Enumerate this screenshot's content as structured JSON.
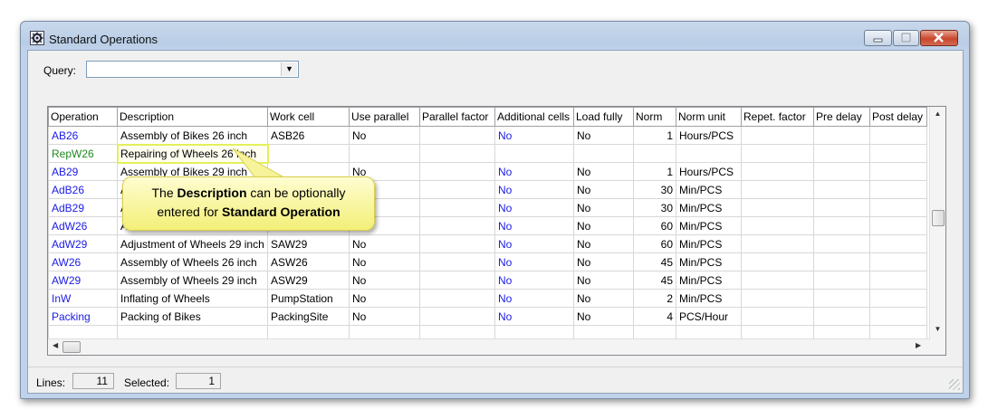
{
  "window": {
    "title": "Standard Operations"
  },
  "query": {
    "label": "Query:",
    "value": ""
  },
  "grid": {
    "columns": [
      "Operation",
      "Description",
      "Work cell",
      "Use parallel",
      "Parallel factor",
      "Additional cells",
      "Load fully",
      "Norm",
      "Norm unit",
      "Repet. factor",
      "Pre delay",
      "Post delay"
    ],
    "rows": [
      {
        "operation": "AB26",
        "description": "Assembly of Bikes 26 inch",
        "work_cell": "ASB26",
        "use_parallel": "No",
        "parallel_factor": "",
        "additional_cells": "No",
        "load_fully": "No",
        "norm": "1",
        "norm_unit": "Hours/PCS",
        "repet_factor": "",
        "pre_delay": "",
        "post_delay": ""
      },
      {
        "operation": "RepW26",
        "description": "Repairing of Wheels 26 inch",
        "work_cell": "",
        "use_parallel": "",
        "parallel_factor": "",
        "additional_cells": "",
        "load_fully": "",
        "norm": "",
        "norm_unit": "",
        "repet_factor": "",
        "pre_delay": "",
        "post_delay": ""
      },
      {
        "operation": "AB29",
        "description": "Assembly of Bikes 29 inch",
        "work_cell": "",
        "use_parallel": "No",
        "parallel_factor": "",
        "additional_cells": "No",
        "load_fully": "No",
        "norm": "1",
        "norm_unit": "Hours/PCS",
        "repet_factor": "",
        "pre_delay": "",
        "post_delay": ""
      },
      {
        "operation": "AdB26",
        "description": "Ad",
        "work_cell": "",
        "use_parallel": "",
        "parallel_factor": "",
        "additional_cells": "No",
        "load_fully": "No",
        "norm": "30",
        "norm_unit": "Min/PCS",
        "repet_factor": "",
        "pre_delay": "",
        "post_delay": ""
      },
      {
        "operation": "AdB29",
        "description": "Ad",
        "work_cell": "",
        "use_parallel": "",
        "parallel_factor": "",
        "additional_cells": "No",
        "load_fully": "No",
        "norm": "30",
        "norm_unit": "Min/PCS",
        "repet_factor": "",
        "pre_delay": "",
        "post_delay": ""
      },
      {
        "operation": "AdW26",
        "description": "Ad",
        "work_cell": "",
        "use_parallel": "",
        "parallel_factor": "",
        "additional_cells": "No",
        "load_fully": "No",
        "norm": "60",
        "norm_unit": "Min/PCS",
        "repet_factor": "",
        "pre_delay": "",
        "post_delay": ""
      },
      {
        "operation": "AdW29",
        "description": "Adjustment of Wheels 29 inch",
        "work_cell": "SAW29",
        "use_parallel": "No",
        "parallel_factor": "",
        "additional_cells": "No",
        "load_fully": "No",
        "norm": "60",
        "norm_unit": "Min/PCS",
        "repet_factor": "",
        "pre_delay": "",
        "post_delay": ""
      },
      {
        "operation": "AW26",
        "description": "Assembly of Wheels 26 inch",
        "work_cell": "ASW26",
        "use_parallel": "No",
        "parallel_factor": "",
        "additional_cells": "No",
        "load_fully": "No",
        "norm": "45",
        "norm_unit": "Min/PCS",
        "repet_factor": "",
        "pre_delay": "",
        "post_delay": ""
      },
      {
        "operation": "AW29",
        "description": "Assembly of Wheels 29 inch",
        "work_cell": "ASW29",
        "use_parallel": "No",
        "parallel_factor": "",
        "additional_cells": "No",
        "load_fully": "No",
        "norm": "45",
        "norm_unit": "Min/PCS",
        "repet_factor": "",
        "pre_delay": "",
        "post_delay": ""
      },
      {
        "operation": "InW",
        "description": "Inflating of Wheels",
        "work_cell": "PumpStation",
        "use_parallel": "No",
        "parallel_factor": "",
        "additional_cells": "No",
        "load_fully": "No",
        "norm": "2",
        "norm_unit": "Min/PCS",
        "repet_factor": "",
        "pre_delay": "",
        "post_delay": ""
      },
      {
        "operation": "Packing",
        "description": "Packing of Bikes",
        "work_cell": "PackingSite",
        "use_parallel": "No",
        "parallel_factor": "",
        "additional_cells": "No",
        "load_fully": "No",
        "norm": "4",
        "norm_unit": "PCS/Hour",
        "repet_factor": "",
        "pre_delay": "",
        "post_delay": ""
      }
    ],
    "editing_row": 1
  },
  "status": {
    "lines_label": "Lines:",
    "lines_value": "11",
    "selected_label": "Selected:",
    "selected_value": "1"
  },
  "callout": {
    "line1_pre": "The ",
    "line1_bold": "Description",
    "line1_post": " can be optionally",
    "line2_pre": "entered for ",
    "line2_bold": "Standard Operation"
  },
  "colors": {
    "link_blue": "#1a1ae6",
    "new_row_green": "#1f8a1f",
    "callout_yellow": "#f3ef78"
  },
  "icons": [
    "app-gear-icon",
    "minimize-icon",
    "maximize-icon",
    "close-icon",
    "dropdown-arrow-icon",
    "scroll-up-icon",
    "scroll-down-icon",
    "scroll-left-icon",
    "scroll-right-icon",
    "resize-grip-icon"
  ]
}
